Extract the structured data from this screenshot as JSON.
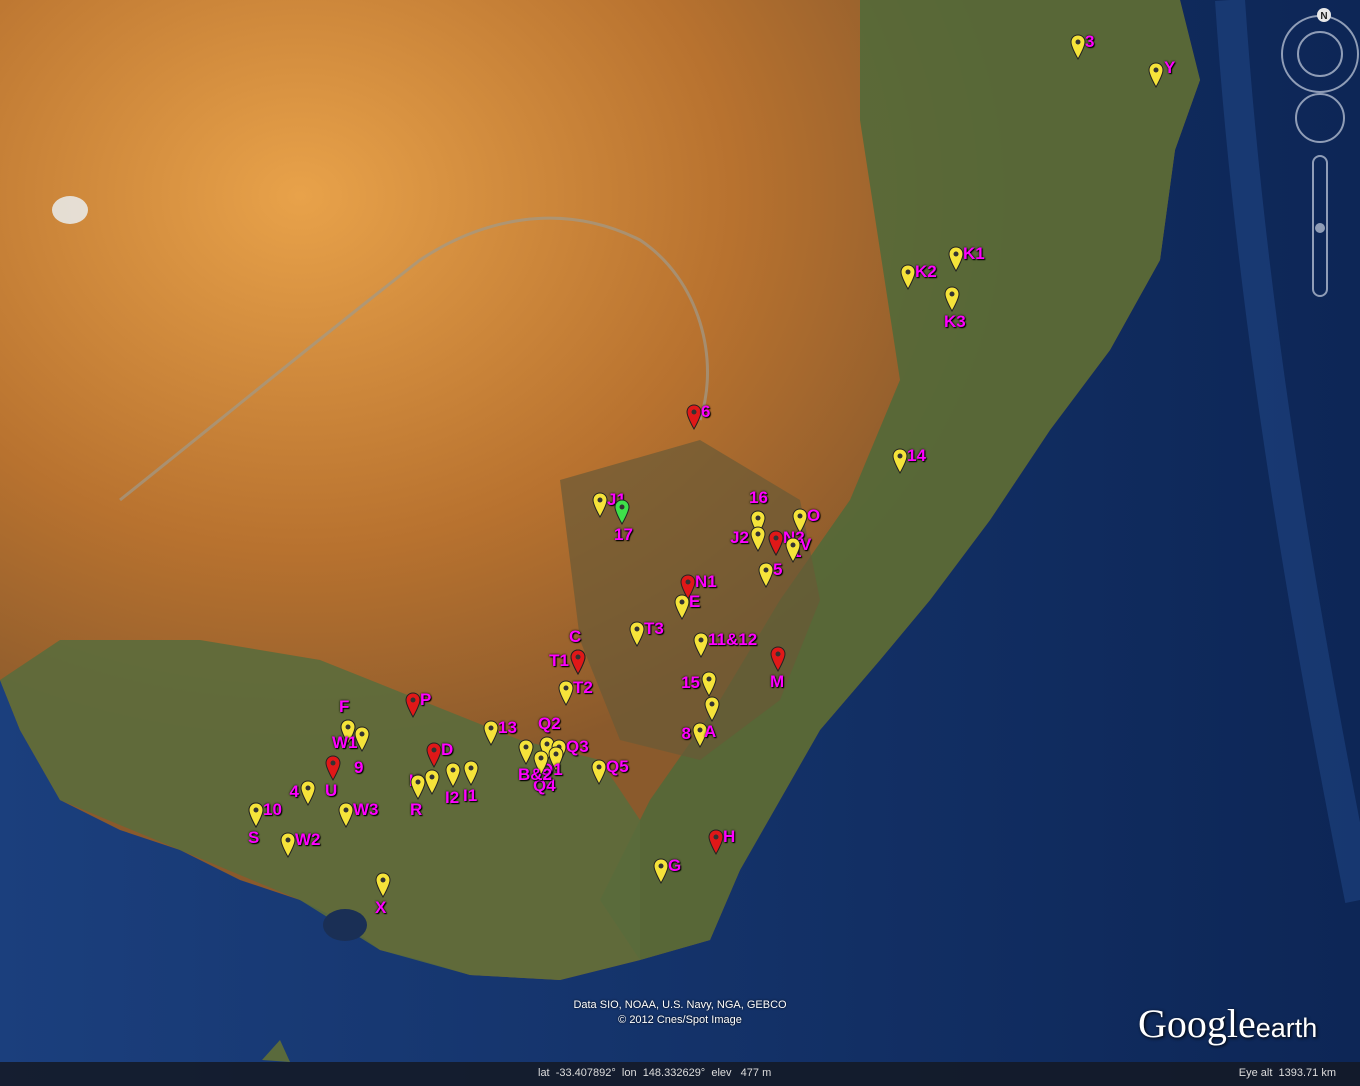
{
  "attribution": {
    "line1": "Data SIO, NOAA, U.S. Navy, NGA, GEBCO",
    "line2": "© 2012 Cnes/Spot Image"
  },
  "logo": {
    "main": "Google",
    "sub": "earth"
  },
  "status": {
    "coordinates": "lat  -33.407892°  lon  148.332629°  elev   477 m",
    "eye_altitude": "Eye alt  1393.71 km"
  },
  "compass": {
    "north_label": "N"
  },
  "colors": {
    "label": "#ff00ff",
    "pin_yellow": "#f5e33a",
    "pin_red": "#e01818",
    "pin_green": "#3ee04a"
  },
  "markers": [
    {
      "label": "3",
      "color": "yellow"
    },
    {
      "label": "Y",
      "color": "yellow"
    },
    {
      "label": "K1",
      "color": "yellow"
    },
    {
      "label": "K2",
      "color": "yellow"
    },
    {
      "label": "K3",
      "color": "yellow"
    },
    {
      "label": "6",
      "color": "red"
    },
    {
      "label": "14",
      "color": "yellow"
    },
    {
      "label": "J1",
      "color": "yellow"
    },
    {
      "label": "17",
      "color": "green"
    },
    {
      "label": "16",
      "color": "yellow"
    },
    {
      "label": "O",
      "color": "yellow"
    },
    {
      "label": "J2",
      "color": "yellow"
    },
    {
      "label": "N2",
      "color": "yellow"
    },
    {
      "label": "1",
      "color": "red"
    },
    {
      "label": "V",
      "color": "yellow"
    },
    {
      "label": "5",
      "color": "yellow"
    },
    {
      "label": "N1",
      "color": "red"
    },
    {
      "label": "E",
      "color": "yellow"
    },
    {
      "label": "T3",
      "color": "yellow"
    },
    {
      "label": "11&12",
      "color": "yellow"
    },
    {
      "label": "C",
      "color": "red"
    },
    {
      "label": "T1",
      "color": "red"
    },
    {
      "label": "T2",
      "color": "yellow"
    },
    {
      "label": "M",
      "color": "red"
    },
    {
      "label": "15",
      "color": "yellow"
    },
    {
      "label": "8",
      "color": "yellow"
    },
    {
      "label": "A",
      "color": "yellow"
    },
    {
      "label": "P",
      "color": "red"
    },
    {
      "label": "F",
      "color": "yellow"
    },
    {
      "label": "W1",
      "color": "yellow"
    },
    {
      "label": "9",
      "color": "yellow"
    },
    {
      "label": "4",
      "color": "yellow"
    },
    {
      "label": "U",
      "color": "red"
    },
    {
      "label": "13",
      "color": "yellow"
    },
    {
      "label": "Q2",
      "color": "yellow"
    },
    {
      "label": "Q3",
      "color": "yellow"
    },
    {
      "label": "Q1",
      "color": "yellow"
    },
    {
      "label": "Q4",
      "color": "yellow"
    },
    {
      "label": "Q5",
      "color": "yellow"
    },
    {
      "label": "D",
      "color": "red"
    },
    {
      "label": "I3",
      "color": "yellow"
    },
    {
      "label": "I2",
      "color": "yellow"
    },
    {
      "label": "I1",
      "color": "yellow"
    },
    {
      "label": "B&2",
      "color": "yellow"
    },
    {
      "label": "R",
      "color": "yellow"
    },
    {
      "label": "10",
      "color": "yellow"
    },
    {
      "label": "S",
      "color": "yellow"
    },
    {
      "label": "W2",
      "color": "yellow"
    },
    {
      "label": "W3",
      "color": "yellow"
    },
    {
      "label": "X",
      "color": "yellow"
    },
    {
      "label": "H",
      "color": "red"
    },
    {
      "label": "G",
      "color": "yellow"
    }
  ]
}
